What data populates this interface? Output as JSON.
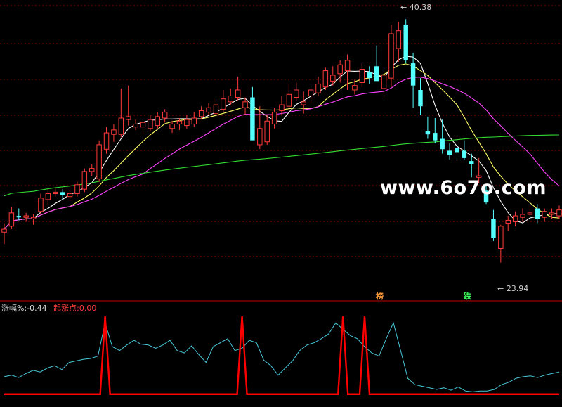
{
  "indicator": {
    "name": "涨幅%:",
    "value": "-0.44",
    "rise_label": "起涨点:",
    "rise_value": "0.00"
  },
  "annotations": {
    "high": "40.38",
    "low": "23.94",
    "badge_a": "榜",
    "badge_b": "跌"
  },
  "watermark": "www.6o7o.com",
  "colors": {
    "up": "#ff3b3b",
    "down": "#54ffff",
    "ma5": "#ffffff",
    "ma10": "#ffff66",
    "ma20": "#ff44ff",
    "ma60": "#33dd33",
    "grid": "#8b0000",
    "ind_line": "#48c8d8",
    "ind_signal": "#ff0000"
  },
  "chart_data": [
    {
      "type": "candlestick",
      "ylim": [
        22.5,
        41.2
      ],
      "grid": true,
      "candles": [
        [
          26.0,
          26.6,
          25.2,
          26.2
        ],
        [
          26.4,
          27.7,
          26.2,
          27.3
        ],
        [
          27.1,
          27.6,
          26.8,
          27.0
        ],
        [
          27.0,
          27.3,
          26.7,
          27.1
        ],
        [
          26.9,
          27.2,
          26.5,
          27.0
        ],
        [
          27.4,
          28.6,
          27.2,
          28.3
        ],
        [
          28.2,
          28.9,
          27.8,
          28.6
        ],
        [
          28.6,
          29.0,
          28.4,
          28.7
        ],
        [
          28.7,
          28.9,
          28.2,
          28.5
        ],
        [
          28.4,
          28.8,
          28.1,
          28.6
        ],
        [
          28.6,
          29.4,
          28.4,
          29.2
        ],
        [
          28.9,
          30.3,
          28.7,
          30.1
        ],
        [
          30.1,
          30.6,
          29.8,
          30.3
        ],
        [
          29.6,
          32.2,
          29.4,
          31.9
        ],
        [
          31.6,
          33.1,
          31.3,
          32.7
        ],
        [
          32.6,
          33.3,
          32.1,
          32.9
        ],
        [
          32.6,
          35.7,
          32.4,
          33.7
        ],
        [
          33.6,
          35.9,
          33.2,
          33.8
        ],
        [
          33.1,
          33.6,
          32.9,
          33.3
        ],
        [
          33.1,
          33.7,
          32.9,
          33.4
        ],
        [
          33.0,
          33.9,
          32.8,
          33.6
        ],
        [
          33.2,
          34.1,
          33.0,
          33.8
        ],
        [
          33.7,
          34.3,
          33.4,
          34.1
        ],
        [
          33.0,
          33.5,
          32.7,
          33.3
        ],
        [
          33.3,
          33.7,
          32.9,
          33.5
        ],
        [
          33.2,
          33.9,
          33.0,
          33.6
        ],
        [
          33.3,
          34.1,
          33.1,
          33.7
        ],
        [
          33.8,
          34.5,
          33.6,
          34.2
        ],
        [
          34.1,
          34.7,
          33.9,
          34.4
        ],
        [
          34.0,
          35.0,
          33.8,
          34.6
        ],
        [
          34.3,
          35.6,
          34.1,
          35.0
        ],
        [
          34.8,
          35.7,
          34.6,
          35.2
        ],
        [
          35.1,
          36.5,
          34.9,
          35.6
        ],
        [
          34.4,
          35.1,
          33.9,
          34.8
        ],
        [
          35.1,
          35.8,
          33.0,
          32.2
        ],
        [
          31.9,
          34.5,
          31.6,
          33.0
        ],
        [
          32.1,
          33.9,
          31.9,
          33.5
        ],
        [
          33.3,
          34.4,
          33.0,
          34.1
        ],
        [
          34.2,
          35.2,
          33.9,
          34.6
        ],
        [
          34.5,
          36.0,
          34.3,
          35.3
        ],
        [
          35.1,
          36.1,
          34.9,
          35.6
        ],
        [
          34.6,
          35.5,
          34.0,
          34.8
        ],
        [
          35.2,
          35.9,
          34.7,
          35.6
        ],
        [
          35.4,
          36.5,
          35.2,
          36.0
        ],
        [
          35.8,
          37.1,
          35.6,
          36.9
        ],
        [
          36.2,
          37.2,
          35.9,
          36.6
        ],
        [
          36.7,
          37.6,
          36.1,
          37.3
        ],
        [
          36.9,
          38.0,
          35.6,
          37.6
        ],
        [
          35.6,
          36.3,
          35.3,
          35.9
        ],
        [
          36.1,
          37.4,
          35.8,
          37.0
        ],
        [
          36.8,
          37.2,
          36.0,
          36.4
        ],
        [
          37.2,
          38.6,
          36.5,
          36.2
        ],
        [
          35.7,
          37.0,
          35.1,
          36.6
        ],
        [
          36.4,
          40.0,
          35.8,
          39.4
        ],
        [
          38.4,
          40.2,
          37.5,
          39.6
        ],
        [
          40.0,
          40.38,
          37.4,
          37.6
        ],
        [
          37.4,
          38.1,
          34.4,
          35.9
        ],
        [
          35.6,
          36.4,
          33.9,
          34.5
        ],
        [
          32.8,
          33.8,
          32.3,
          32.6
        ],
        [
          32.7,
          33.7,
          32.0,
          32.2
        ],
        [
          32.3,
          33.6,
          31.3,
          31.6
        ],
        [
          31.5,
          32.0,
          30.9,
          31.2
        ],
        [
          31.7,
          32.4,
          30.8,
          31.4
        ],
        [
          31.5,
          32.2,
          30.9,
          31.0
        ],
        [
          30.8,
          31.3,
          29.7,
          30.6
        ],
        [
          29.7,
          31.0,
          29.3,
          29.8
        ],
        [
          28.8,
          29.2,
          27.9,
          28.0
        ],
        [
          26.9,
          27.5,
          25.4,
          25.6
        ],
        [
          24.9,
          26.5,
          23.94,
          26.4
        ],
        [
          26.6,
          27.1,
          26.1,
          26.8
        ],
        [
          26.7,
          27.4,
          26.4,
          27.1
        ],
        [
          27.0,
          27.6,
          26.7,
          27.2
        ],
        [
          27.2,
          27.8,
          27.0,
          27.3
        ],
        [
          27.6,
          27.9,
          26.6,
          26.9
        ],
        [
          27.0,
          27.6,
          26.7,
          27.4
        ],
        [
          27.2,
          27.6,
          26.9,
          27.3
        ],
        [
          27.1,
          27.8,
          26.9,
          27.5
        ]
      ],
      "ma": [
        {
          "period": 5,
          "color": "#ffffff"
        },
        {
          "period": 10,
          "color": "#ffff66"
        },
        {
          "period": 20,
          "color": "#ff44ff"
        },
        {
          "period": 60,
          "color": "#33dd33"
        }
      ]
    },
    {
      "type": "line",
      "ylim": [
        -2,
        100
      ],
      "series": [
        {
          "values": [
            22,
            24,
            21,
            26,
            30,
            28,
            33,
            36,
            31,
            40,
            42,
            44,
            45,
            48,
            90,
            60,
            55,
            62,
            68,
            63,
            62,
            58,
            62,
            68,
            55,
            52,
            61,
            50,
            40,
            60,
            65,
            70,
            55,
            58,
            68,
            65,
            43,
            36,
            24,
            33,
            42,
            55,
            62,
            65,
            70,
            76,
            90,
            82,
            74,
            70,
            60,
            52,
            48,
            70,
            90,
            55,
            20,
            12,
            10,
            8,
            6,
            8,
            5,
            9,
            4,
            3,
            4,
            4,
            6,
            12,
            15,
            20,
            22,
            23,
            21,
            24,
            26,
            28
          ]
        }
      ],
      "signals": [
        14,
        33,
        47,
        50
      ]
    }
  ]
}
